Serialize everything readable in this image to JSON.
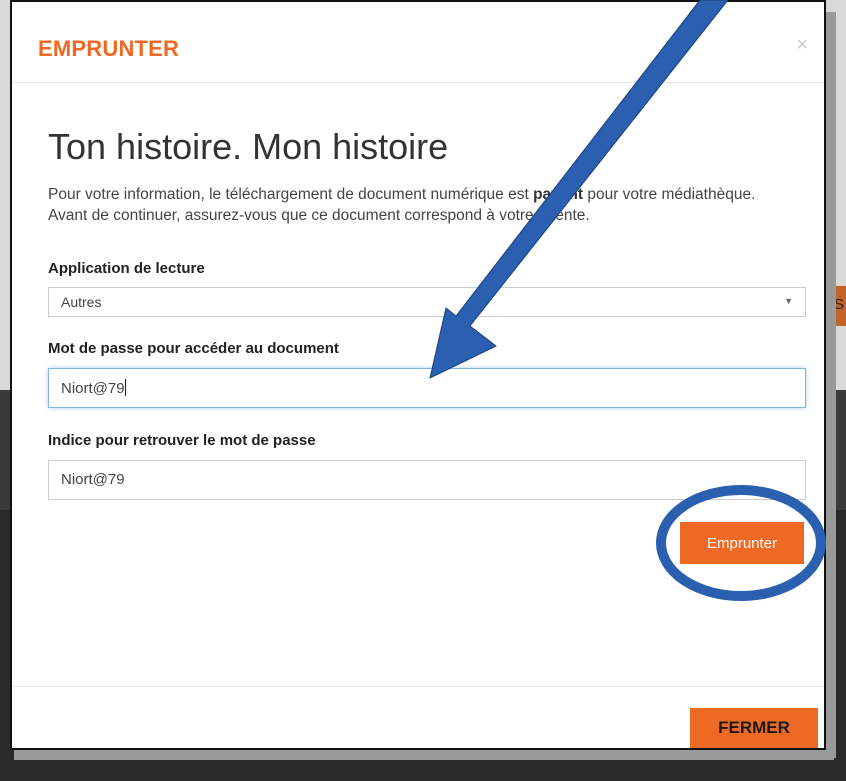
{
  "modal": {
    "title": "EMPRUNTER",
    "close_symbol": "×",
    "doc_title": "Ton histoire. Mon histoire",
    "info_line1_prefix": "Pour votre information, le téléchargement de document numérique est ",
    "info_bold": "payant",
    "info_line1_suffix": " pour votre médiathèque.",
    "info_line2": "Avant de continuer, assurez-vous que ce document correspond à votre attente.",
    "reading_app_label": "Application de lecture",
    "reading_app_value": "Autres",
    "password_label": "Mot de passe pour accéder au document",
    "password_value": "Niort@79",
    "hint_label": "Indice pour retrouver le mot de passe",
    "hint_value": "Niort@79",
    "borrow_button": "Emprunter",
    "close_button": "FERMER"
  },
  "background": {
    "side_letter": "S"
  },
  "colors": {
    "accent": "#ee6a24",
    "annotation_blue": "#2b5fb0"
  },
  "annotations": {
    "arrow": "arrow-pointing-to-password-field",
    "ellipse": "circle-around-borrow-button"
  }
}
